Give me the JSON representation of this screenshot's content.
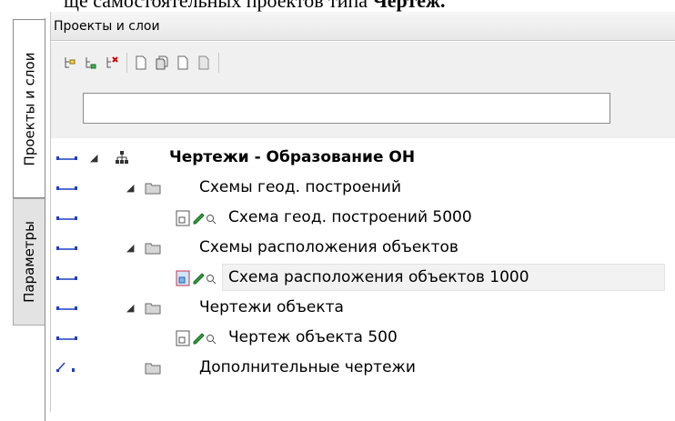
{
  "document": {
    "text_before": "ще самостоятельных проектов типа ",
    "text_bold": "Чертеж."
  },
  "tabs": {
    "active_label": "Проекты и слои",
    "inactive_label": "Параметры"
  },
  "panel": {
    "title": "Проекты и слои"
  },
  "toolbar": {
    "buttons": [
      "add-layer-icon",
      "add-sublayer-icon",
      "delete-layer-icon",
      "new-sheet-icon",
      "copy-sheet-icon",
      "page-icon",
      "page-gray-icon"
    ]
  },
  "search": {
    "value": "",
    "placeholder": ""
  },
  "tree": {
    "root": "Чертежи - Образование ОН",
    "group1": "Схемы геод. построений",
    "item1": "Схема геод. построений 5000",
    "group2": "Схемы расположения объектов",
    "item2": "Схема расположения объектов 1000",
    "group3": "Чертежи объекта",
    "item3": "Чертеж объекта 500",
    "group4": "Дополнительные чертежи"
  },
  "colors": {
    "link_icon": "#1f3fbf",
    "selection": "#f2f2f2",
    "folder": "#c8c8c8"
  }
}
